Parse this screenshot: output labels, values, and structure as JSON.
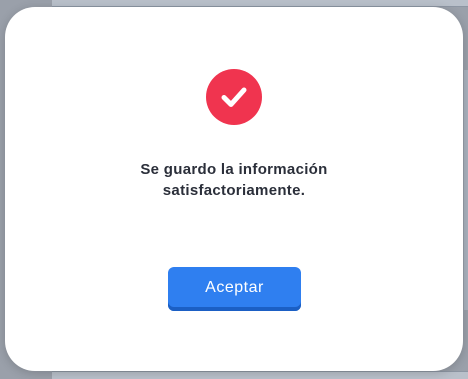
{
  "dialog": {
    "icon": "check-circle-icon",
    "message_line1": "Se guardo la información",
    "message_line2": "satisfactoriamente.",
    "accept_label": "Aceptar"
  },
  "colors": {
    "icon_bg": "#f0344f",
    "button_bg": "#2f7ff0",
    "text": "#2b2f3a"
  }
}
